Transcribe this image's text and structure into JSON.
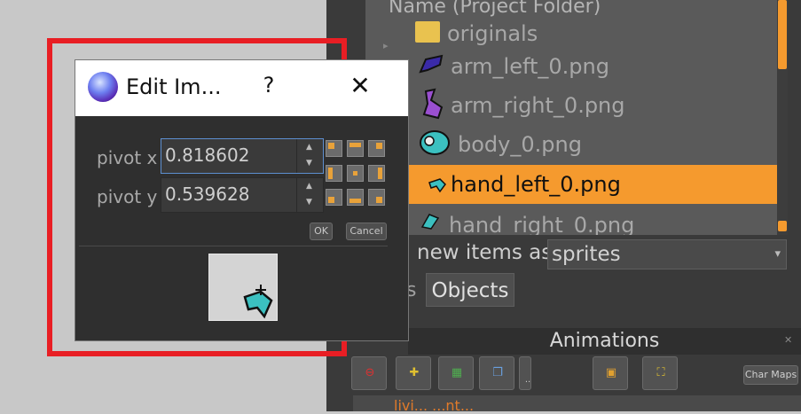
{
  "app": {
    "tree": {
      "header": "Name     (Project Folder)",
      "folder_label": "originals",
      "items": [
        {
          "label": "arm_left_0.png",
          "icon": "arm-left-sprite-icon",
          "selected": false
        },
        {
          "label": "arm_right_0.png",
          "icon": "arm-right-sprite-icon",
          "selected": false
        },
        {
          "label": "body_0.png",
          "icon": "body-sprite-icon",
          "selected": false
        },
        {
          "label": "hand_left_0.png",
          "icon": "hand-left-sprite-icon",
          "selected": true
        },
        {
          "label": "hand_right_0.png",
          "icon": "hand-right-sprite-icon",
          "selected": false
        }
      ]
    },
    "new_items_label": "new items as",
    "new_items_value": "sprites",
    "tab_objects": "Objects",
    "animations_title": "Animations",
    "char_maps_label": "Char Maps",
    "bottom_text": "livi...   ...nt..."
  },
  "dialog": {
    "title": "Edit Im...",
    "help_label": "?",
    "close_label": "✕",
    "pivot_x_label": "pivot x",
    "pivot_x_value": "0.818602",
    "pivot_y_label": "pivot y",
    "pivot_y_value": "0.539628",
    "ok_label": "OK",
    "cancel_label": "Cancel"
  },
  "colors": {
    "highlight": "#e81e24",
    "selection": "#f59a2e",
    "focus_border": "#5d8fd0"
  }
}
